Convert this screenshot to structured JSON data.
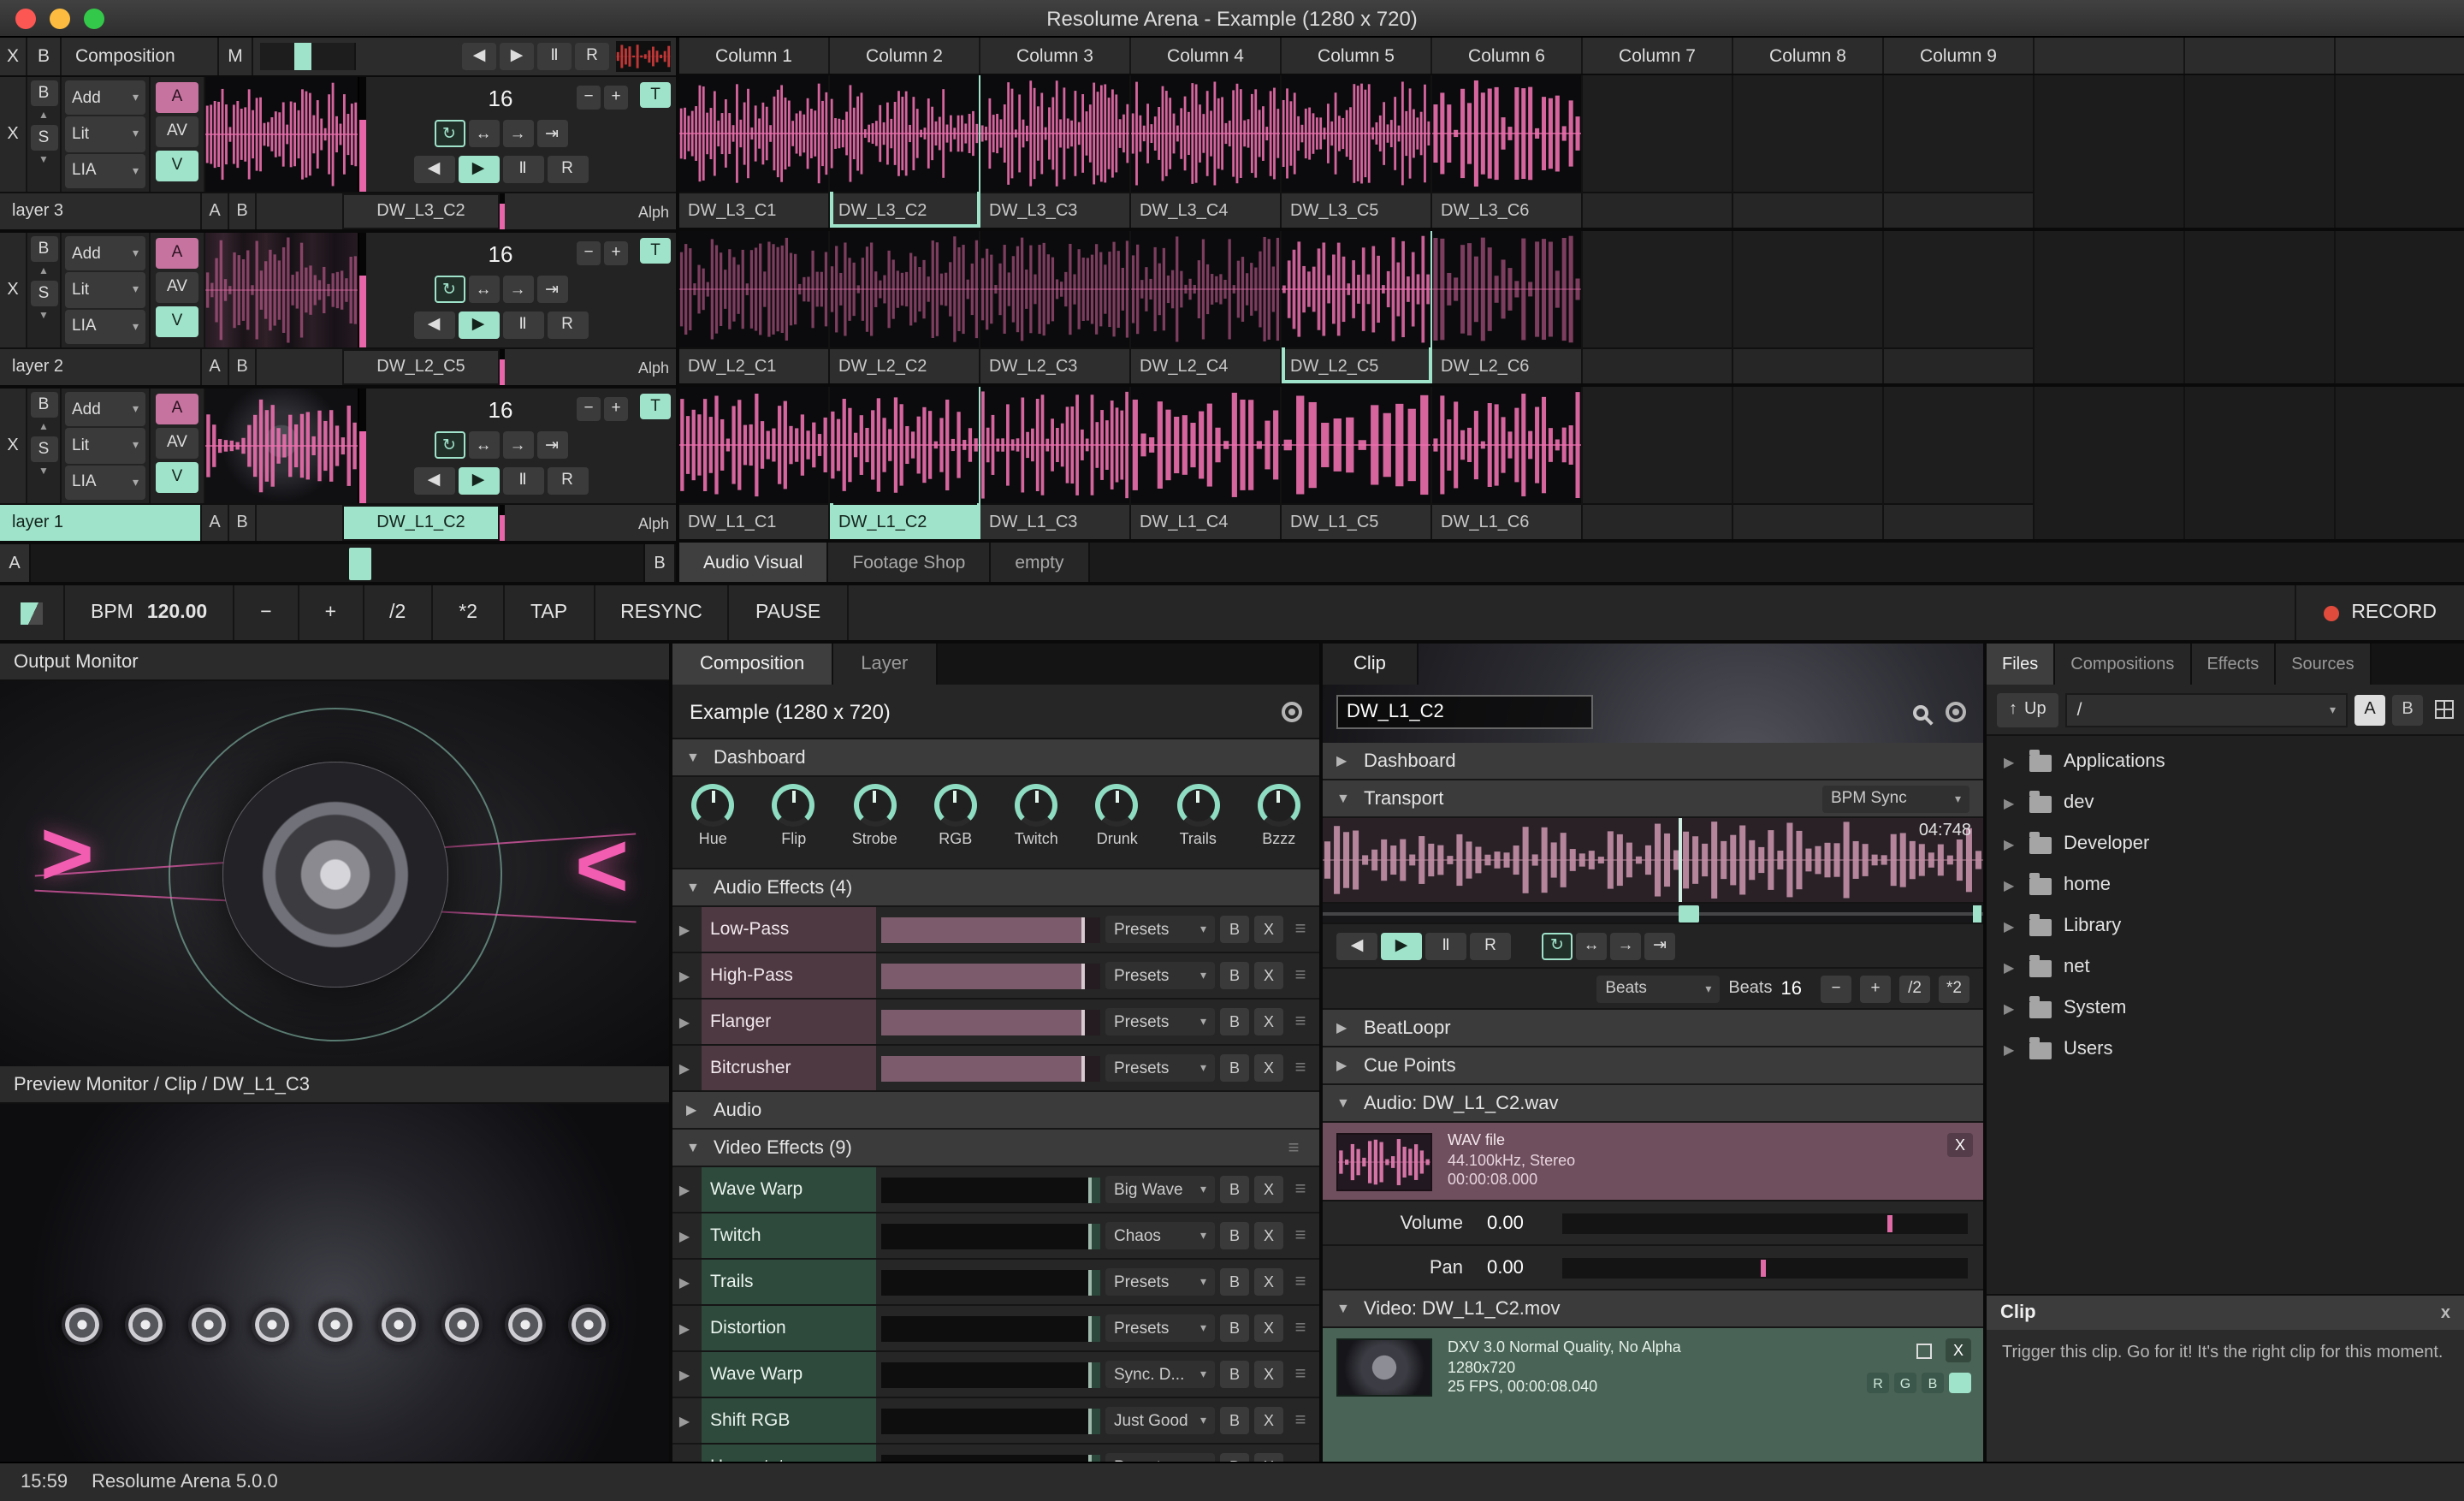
{
  "window": {
    "title": "Resolume Arena - Example (1280 x 720)"
  },
  "icons": {
    "back": "◀",
    "play": "▶",
    "pause": "Ⅱ",
    "resync": "R",
    "loop": "↻",
    "bounce": "↔",
    "forward": "→",
    "once": "⇥",
    "minus": "−",
    "plus": "+",
    "half": "/2",
    "double": "*2",
    "dropdown": "▾",
    "open": "▼",
    "closed": "▶",
    "up": "▲",
    "down": "▼",
    "menu": "≡",
    "close": "x",
    "close_big": "X",
    "up_arrow": "↑",
    "record_dot": "●",
    "arrow_gt": ">",
    "arrow_lt": "<"
  },
  "composition_strip": {
    "x": "X",
    "b": "B",
    "label": "Composition",
    "m": "M"
  },
  "layer_controls": {
    "x": "X",
    "b": "B",
    "s": "S",
    "add": "Add",
    "lit": "Lit",
    "lia": "LIA",
    "a": "A",
    "av": "AV",
    "v": "V",
    "t": "T",
    "beats": "16",
    "alpha": "Alph",
    "a_label": "A",
    "b_label": "B"
  },
  "layers": [
    {
      "name": "layer 3",
      "clip": "DW_L3_C2"
    },
    {
      "name": "layer 2",
      "clip": "DW_L2_C5"
    },
    {
      "name": "layer 1",
      "clip": "DW_L1_C2"
    }
  ],
  "crossfader": {
    "a": "A",
    "b": "B"
  },
  "grid": {
    "columns": [
      "Column 1",
      "Column 2",
      "Column 3",
      "Column 4",
      "Column 5",
      "Column 6",
      "Column 7",
      "Column 8",
      "Column 9"
    ],
    "rows": [
      {
        "clips": [
          "DW_L3_C1",
          "DW_L3_C2",
          "DW_L3_C3",
          "DW_L3_C4",
          "DW_L3_C5",
          "DW_L3_C6"
        ]
      },
      {
        "clips": [
          "DW_L2_C1",
          "DW_L2_C2",
          "DW_L2_C3",
          "DW_L2_C4",
          "DW_L2_C5",
          "DW_L2_C6"
        ]
      },
      {
        "clips": [
          "DW_L1_C1",
          "DW_L1_C2",
          "DW_L1_C3",
          "DW_L1_C4",
          "DW_L1_C5",
          "DW_L1_C6"
        ]
      }
    ],
    "decks": [
      "Audio Visual",
      "Footage Shop",
      "empty"
    ]
  },
  "bpm_bar": {
    "bpm_label": "BPM",
    "bpm_value": "120.00",
    "tap": "TAP",
    "resync": "RESYNC",
    "pause": "PAUSE",
    "record": "RECORD"
  },
  "monitors": {
    "output": "Output Monitor",
    "preview": "Preview Monitor / Clip / DW_L1_C3"
  },
  "composition_panel": {
    "tabs": {
      "composition": "Composition",
      "layer": "Layer"
    },
    "title": "Example (1280 x 720)",
    "dashboard": "Dashboard",
    "knobs": [
      "Hue",
      "Flip",
      "Strobe",
      "RGB",
      "Twitch",
      "Drunk",
      "Trails",
      "Bzzz"
    ],
    "audio_effects_header": "Audio Effects (4)",
    "audio_effects": [
      {
        "name": "Low-Pass",
        "preset": "Presets"
      },
      {
        "name": "High-Pass",
        "preset": "Presets"
      },
      {
        "name": "Flanger",
        "preset": "Presets"
      },
      {
        "name": "Bitcrusher",
        "preset": "Presets"
      }
    ],
    "audio_header": "Audio",
    "video_effects_header": "Video Effects (9)",
    "video_effects": [
      {
        "name": "Wave Warp",
        "preset": "Big Wave"
      },
      {
        "name": "Twitch",
        "preset": "Chaos"
      },
      {
        "name": "Trails",
        "preset": "Presets"
      },
      {
        "name": "Distortion",
        "preset": "Presets"
      },
      {
        "name": "Wave Warp",
        "preset": "Sync. D..."
      },
      {
        "name": "Shift RGB",
        "preset": "Just Good"
      },
      {
        "name": "Hue rotate",
        "preset": "Presets"
      }
    ],
    "bypass": "B",
    "clear": "X"
  },
  "clip_panel": {
    "tab": "Clip",
    "name": "DW_L1_C2",
    "dashboard": "Dashboard",
    "transport": "Transport",
    "bpm_sync": "BPM Sync",
    "time": "04:748",
    "beats_mode": "Beats",
    "beats_label": "Beats",
    "beats_value": "16",
    "beatloopr": "BeatLoopr",
    "cue_points": "Cue Points",
    "audio_header": "Audio: DW_L1_C2.wav",
    "audio_file": {
      "type": "WAV file",
      "format": "44.100kHz, Stereo",
      "duration": "00:00:08.000"
    },
    "volume_label": "Volume",
    "volume_value": "0.00",
    "pan_label": "Pan",
    "pan_value": "0.00",
    "video_header": "Video: DW_L1_C2.mov",
    "video_file": {
      "codec": "DXV 3.0 Normal Quality, No Alpha",
      "resolution": "1280x720",
      "fps": "25 FPS, 00:00:08.040",
      "r": "R",
      "g": "G",
      "b": "B"
    }
  },
  "files_panel": {
    "tabs": [
      "Files",
      "Compositions",
      "Effects",
      "Sources"
    ],
    "up": "Up",
    "path": "/",
    "a": "A",
    "b": "B",
    "folders": [
      "Applications",
      "dev",
      "Developer",
      "home",
      "Library",
      "net",
      "System",
      "Users"
    ],
    "info": {
      "title": "Clip",
      "text": "Trigger this clip. Go for it! It's the right clip for this moment."
    }
  },
  "statusbar": {
    "time": "15:59",
    "app": "Resolume Arena 5.0.0"
  }
}
